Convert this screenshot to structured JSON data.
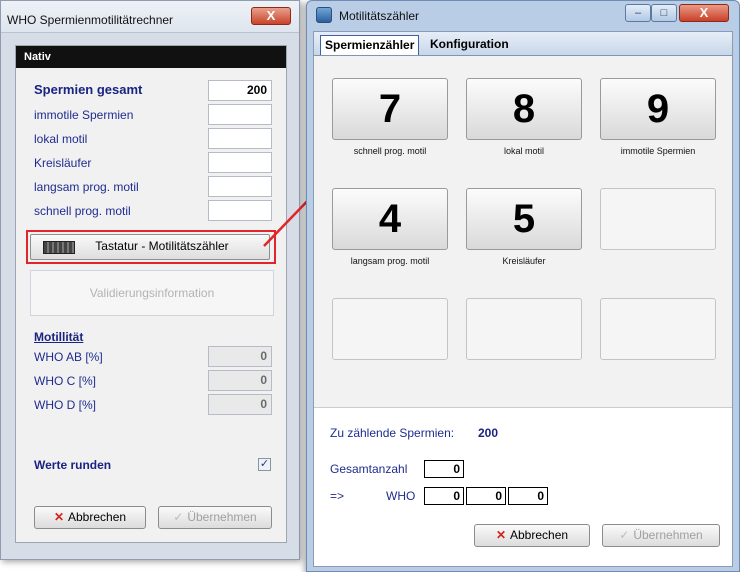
{
  "calc_window": {
    "title": "WHO Spermienmotilitätrechner",
    "close_glyph": "X",
    "panel_header": "Nativ",
    "total_label": "Spermien gesamt",
    "total_value": "200",
    "fields": [
      {
        "label": "immotile Spermien",
        "value": ""
      },
      {
        "label": "lokal motil",
        "value": ""
      },
      {
        "label": "Kreisläufer",
        "value": ""
      },
      {
        "label": "langsam prog. motil",
        "value": ""
      },
      {
        "label": "schnell prog. motil",
        "value": ""
      }
    ],
    "keyboard_button": "Tastatur - Motilitätszähler",
    "validation_info": "Validierungsinformation",
    "motility_section": "Motillität",
    "who_rows": [
      {
        "label": "WHO AB [%]",
        "value": "0"
      },
      {
        "label": "WHO C [%]",
        "value": "0"
      },
      {
        "label": "WHO D [%]",
        "value": "0"
      }
    ],
    "round_label": "Werte runden",
    "round_checked": true,
    "cancel_button": "Abbrechen",
    "apply_button": "Übernehmen"
  },
  "counter_window": {
    "title": "Motilitätszähler",
    "tabs": [
      "Spermienzähler",
      "Konfiguration"
    ],
    "keys": [
      {
        "digit": "7",
        "caption": "schnell prog. motil"
      },
      {
        "digit": "8",
        "caption": "lokal motil"
      },
      {
        "digit": "9",
        "caption": "immotile Spermien"
      },
      {
        "digit": "4",
        "caption": "langsam prog. motil"
      },
      {
        "digit": "5",
        "caption": "Kreisläufer"
      }
    ],
    "to_count_label": "Zu zählende Spermien:",
    "to_count_value": "200",
    "total_count_label": "Gesamtanzahl",
    "total_count_value": "0",
    "arrow_label": "=>",
    "who_label": "WHO",
    "who_values": [
      "0",
      "0",
      "0"
    ],
    "cancel_button": "Abbrechen",
    "apply_button": "Übernehmen",
    "window_buttons": {
      "minimize": "–",
      "maximize": "□",
      "close": "X"
    }
  },
  "colors": {
    "highlight": "#e0252b",
    "label_blue": "#1f2c8f",
    "title_blue": "#b9cde6"
  }
}
